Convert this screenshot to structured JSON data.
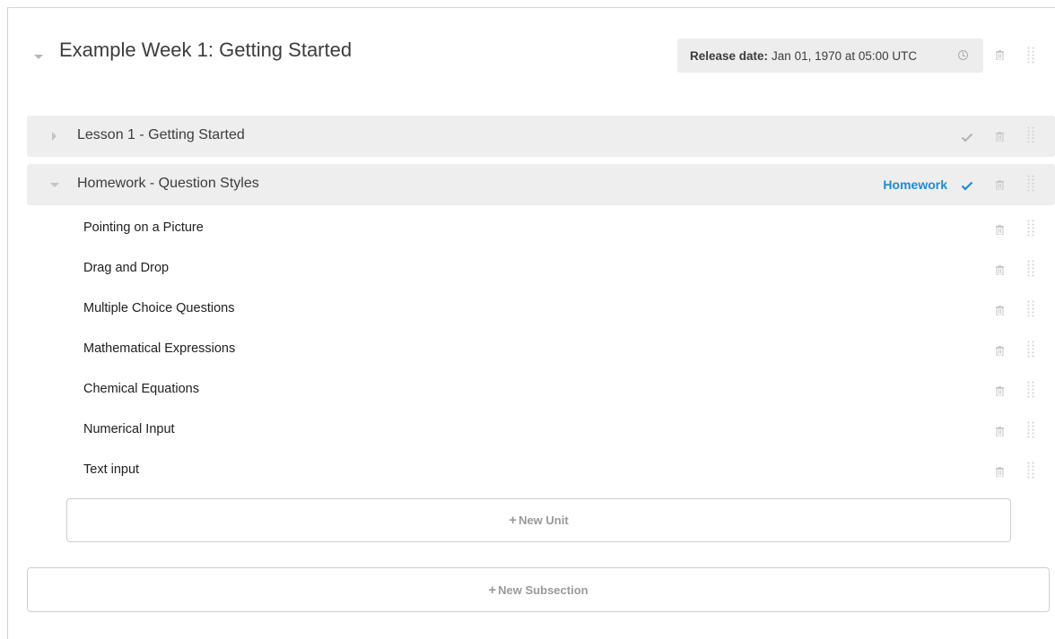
{
  "section": {
    "title": "Example Week 1: Getting Started",
    "release_label": "Release date:",
    "release_value": "Jan 01, 1970 at 05:00 UTC"
  },
  "subsections": [
    {
      "title": "Lesson 1 - Getting Started",
      "expanded": false,
      "grading": "",
      "published": true
    },
    {
      "title": "Homework - Question Styles",
      "expanded": true,
      "grading": "Homework",
      "published": true
    }
  ],
  "units": [
    "Pointing on a Picture",
    "Drag and Drop",
    "Multiple Choice Questions",
    "Mathematical Expressions",
    "Chemical Equations",
    "Numerical Input",
    "Text input"
  ],
  "buttons": {
    "plus": "+",
    "new_unit": "New Unit",
    "new_subsection": "New Subsection"
  },
  "colors": {
    "accent": "#1f8ad6",
    "row_bg": "#eeeeee",
    "check_muted": "#b5b5b5"
  },
  "icons": {
    "delete": "trash-icon",
    "drag": "drag-handle-icon",
    "release": "clock-icon",
    "publish": "check-icon"
  }
}
